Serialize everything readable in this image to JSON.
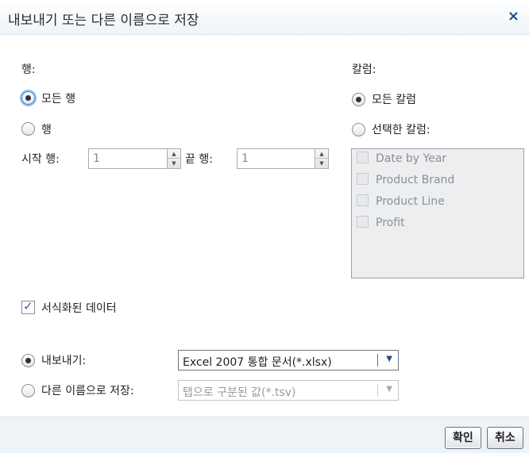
{
  "dialog": {
    "title": "내보내기 또는 다른 이름으로 저장",
    "close_icon": "close-icon",
    "close_glyph": "×"
  },
  "rows": {
    "heading": "행:",
    "all_rows_label": "모든 행",
    "range_label": "행",
    "selected": "all",
    "start_label": "시작 행:",
    "start_value": "1",
    "end_label": "끝 행:",
    "end_value": "1"
  },
  "columns": {
    "heading": "칼럼:",
    "all_columns_label": "모든 칼럼",
    "selected_columns_label": "선택한 칼럼:",
    "selected": "all",
    "items": [
      "Date by Year",
      "Product Brand",
      "Product Line",
      "Profit"
    ]
  },
  "formatted": {
    "label": "서식화된 데이터",
    "checked": true
  },
  "output": {
    "selected": "export",
    "export_label": "내보내기:",
    "export_format": "Excel 2007 통합 문서(*.xlsx)",
    "save_as_label": "다른 이름으로 저장:",
    "save_as_format": "탭으로 구분된 값(*.tsv)"
  },
  "footer": {
    "ok_label": "확인",
    "cancel_label": "취소"
  },
  "colors": {
    "accent": "#1e4f86",
    "footer_bg": "#edf3f6",
    "list_bg": "#eceeef"
  }
}
